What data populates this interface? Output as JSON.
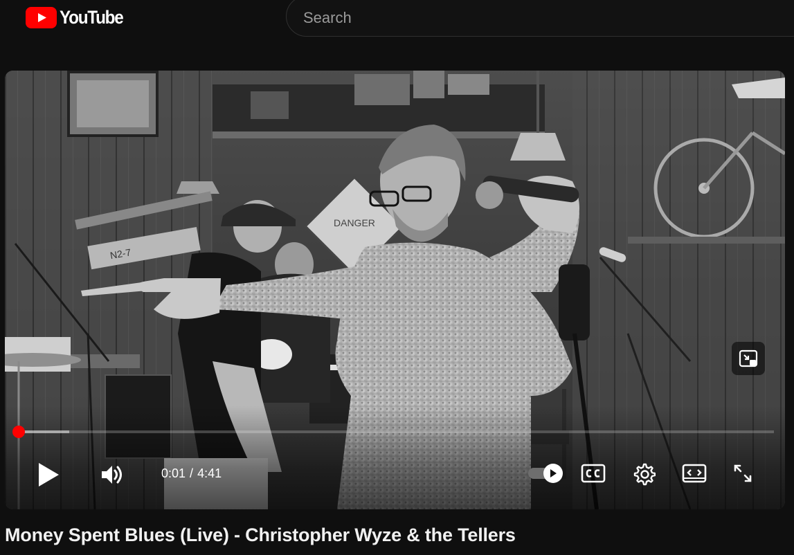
{
  "masthead": {
    "logo_text": "YouTube",
    "logo_icon": "youtube-play-logo-icon",
    "brand_color": "#ff0000",
    "search_placeholder": "Search"
  },
  "player": {
    "current_time": "0:01",
    "separator": "/",
    "duration": "4:41",
    "progress_fraction": 0.0036,
    "buffered_fraction": 0.07,
    "played_color": "#ff0000",
    "autoplay_on": false,
    "controls": [
      {
        "name": "play-button",
        "icon": "play-icon"
      },
      {
        "name": "volume-button",
        "icon": "volume-icon"
      },
      {
        "name": "autoplay-toggle",
        "icon": "autoplay-toggle-icon"
      },
      {
        "name": "subtitles-button",
        "icon": "cc-icon"
      },
      {
        "name": "settings-button",
        "icon": "gear-icon"
      },
      {
        "name": "theater-mode-button",
        "icon": "theater-icon"
      },
      {
        "name": "fullscreen-button",
        "icon": "fullscreen-icon"
      },
      {
        "name": "miniplayer-button",
        "icon": "miniplayer-icon"
      }
    ],
    "scene_signs": [
      "DANGER",
      "N2-7"
    ]
  },
  "video": {
    "title": "Money Spent Blues (Live) - Christopher Wyze & the Tellers"
  }
}
